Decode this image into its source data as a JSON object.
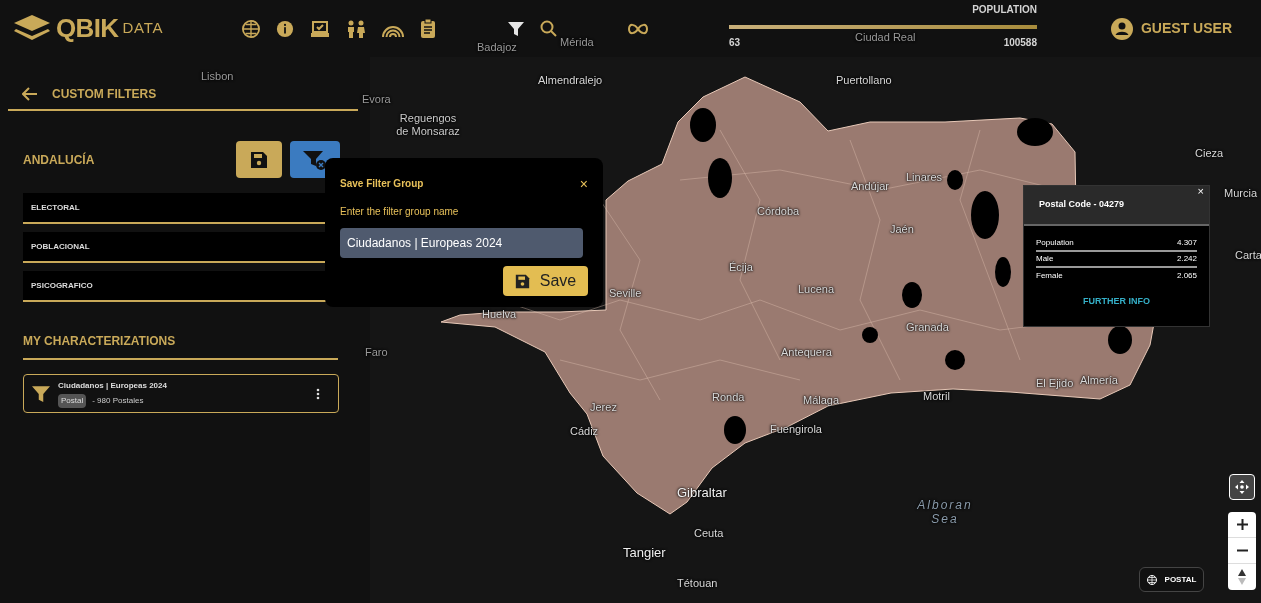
{
  "header": {
    "logo": {
      "brand": "QBIK",
      "suffix": "DATA"
    },
    "population_filter": {
      "label": "POPULATION",
      "min": "63",
      "max": "100588",
      "level": 1
    },
    "user": {
      "name": "GUEST USER"
    }
  },
  "sidebar": {
    "title": "CUSTOM FILTERS",
    "region": "ANDALUCÍA",
    "sections": [
      {
        "label": "ELECTORAL"
      },
      {
        "label": "POBLACIONAL"
      },
      {
        "label": "PSICOGRAFICO"
      }
    ],
    "characterizations": {
      "title": "MY CHARACTERIZATIONS",
      "items": [
        {
          "name": "Ciudadanos | Europeas 2024",
          "tag": "Postal",
          "count": "- 980 Postales"
        }
      ]
    }
  },
  "dialog": {
    "title": "Save Filter Group",
    "close": "×",
    "label": "Enter the filter group name",
    "value": "Ciudadanos | Europeas 2024",
    "button": "Save"
  },
  "map": {
    "labels": [
      {
        "text": "Lisbon"
      },
      {
        "text": "Evora"
      },
      {
        "text": "Reguengos de Monsaraz"
      },
      {
        "text": "Almendralejo"
      },
      {
        "text": "Puertollano"
      },
      {
        "text": "Badajoz"
      },
      {
        "text": "Mérida"
      },
      {
        "text": "Ciudad Real"
      },
      {
        "text": "Córdoba"
      },
      {
        "text": "Andújar"
      },
      {
        "text": "Linares"
      },
      {
        "text": "Jaén"
      },
      {
        "text": "Écija"
      },
      {
        "text": "Lucena"
      },
      {
        "text": "Seville"
      },
      {
        "text": "Huelva"
      },
      {
        "text": "Faro"
      },
      {
        "text": "Granada"
      },
      {
        "text": "Antequera"
      },
      {
        "text": "Ronda"
      },
      {
        "text": "Málaga"
      },
      {
        "text": "Motril"
      },
      {
        "text": "El Ejido"
      },
      {
        "text": "Almería"
      },
      {
        "text": "Jerez"
      },
      {
        "text": "Cádiz"
      },
      {
        "text": "Fuengirola"
      },
      {
        "text": "Gibraltar"
      },
      {
        "text": "Alboran Sea"
      },
      {
        "text": "Ceuta"
      },
      {
        "text": "Tangier"
      },
      {
        "text": "Tétouan"
      },
      {
        "text": "Murcia"
      },
      {
        "text": "Cieza"
      },
      {
        "text": "Carta"
      }
    ],
    "popup": {
      "title": "Postal Code - 04279",
      "close": "×",
      "rows": [
        {
          "label": "Population",
          "value": "4.307"
        },
        {
          "label": "Male",
          "value": "2.242"
        },
        {
          "label": "Female",
          "value": "2.065"
        }
      ],
      "link": "FURTHER INFO"
    },
    "layer_button": "POSTAL"
  }
}
